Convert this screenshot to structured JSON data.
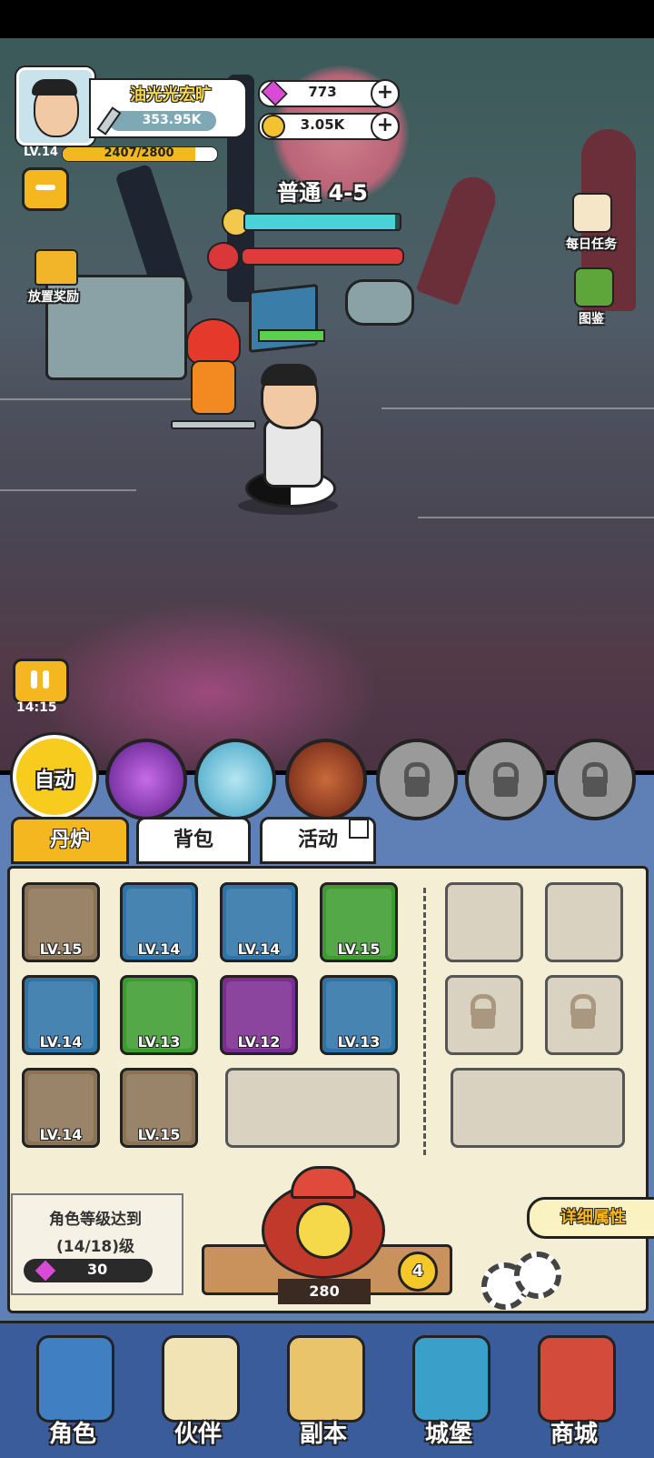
{
  "player": {
    "name": "油光光宏旷",
    "power": "353.95K",
    "level_label": "LV.14",
    "xp_text": "2407/2800",
    "xp_progress": 0.86
  },
  "currency": {
    "gems": "773",
    "coins": "3.05K"
  },
  "stage": {
    "label": "普通 4-5",
    "timer_progress": 0.97,
    "boss_hp_progress": 1.0
  },
  "side_buttons": {
    "idle_reward": "放置奖励",
    "daily_tasks": "每日任务",
    "codex": "图鉴"
  },
  "battle": {
    "time": "14:15"
  },
  "skills": {
    "auto": "自动"
  },
  "tabs": [
    {
      "label": "丹炉"
    },
    {
      "label": "背包"
    },
    {
      "label": "活动"
    }
  ],
  "equipment": [
    {
      "lv": "LV.15",
      "rarity": "brown"
    },
    {
      "lv": "LV.14",
      "rarity": "blue"
    },
    {
      "lv": "LV.14",
      "rarity": "blue"
    },
    {
      "lv": "LV.15",
      "rarity": "green"
    },
    {
      "lv": "LV.14",
      "rarity": "blue"
    },
    {
      "lv": "LV.13",
      "rarity": "green"
    },
    {
      "lv": "LV.12",
      "rarity": "purple"
    },
    {
      "lv": "LV.13",
      "rarity": "blue"
    },
    {
      "lv": "LV.14",
      "rarity": "brown"
    },
    {
      "lv": "LV.15",
      "rarity": "brown"
    }
  ],
  "requirement": {
    "line1": "角色等级达到",
    "line2": "(14/18)级",
    "gem_cost": "30"
  },
  "detail_button": "详细属性",
  "furnace": {
    "value": "280",
    "badge": "4"
  },
  "nav": [
    {
      "label": "角色"
    },
    {
      "label": "伙伴"
    },
    {
      "label": "副本"
    },
    {
      "label": "城堡"
    },
    {
      "label": "商城"
    }
  ],
  "colors": {
    "accent": "#f5b720",
    "panel": "#5f80b6",
    "content": "#f4eed5"
  }
}
